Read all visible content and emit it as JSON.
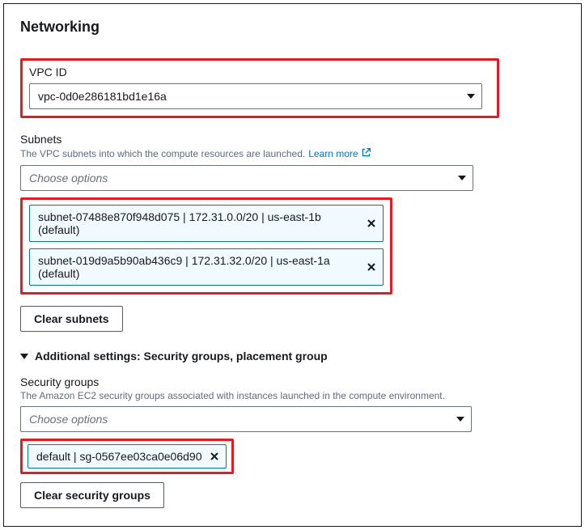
{
  "panel": {
    "title": "Networking"
  },
  "vpc": {
    "label": "VPC ID",
    "value": "vpc-0d0e286181bd1e16a"
  },
  "subnets": {
    "label": "Subnets",
    "help": "The VPC subnets into which the compute resources are launched.",
    "learn_more": "Learn more",
    "placeholder": "Choose options",
    "items": [
      "subnet-07488e870f948d075 | 172.31.0.0/20 | us-east-1b (default)",
      "subnet-019d9a5b90ab436c9 | 172.31.32.0/20 | us-east-1a (default)"
    ],
    "clear_label": "Clear subnets"
  },
  "additional": {
    "toggle_label": "Additional settings: Security groups, placement group"
  },
  "security_groups": {
    "label": "Security groups",
    "help": "The Amazon EC2 security groups associated with instances launched in the compute environment.",
    "placeholder": "Choose options",
    "items": [
      "default | sg-0567ee03ca0e06d90"
    ],
    "clear_label": "Clear security groups"
  }
}
